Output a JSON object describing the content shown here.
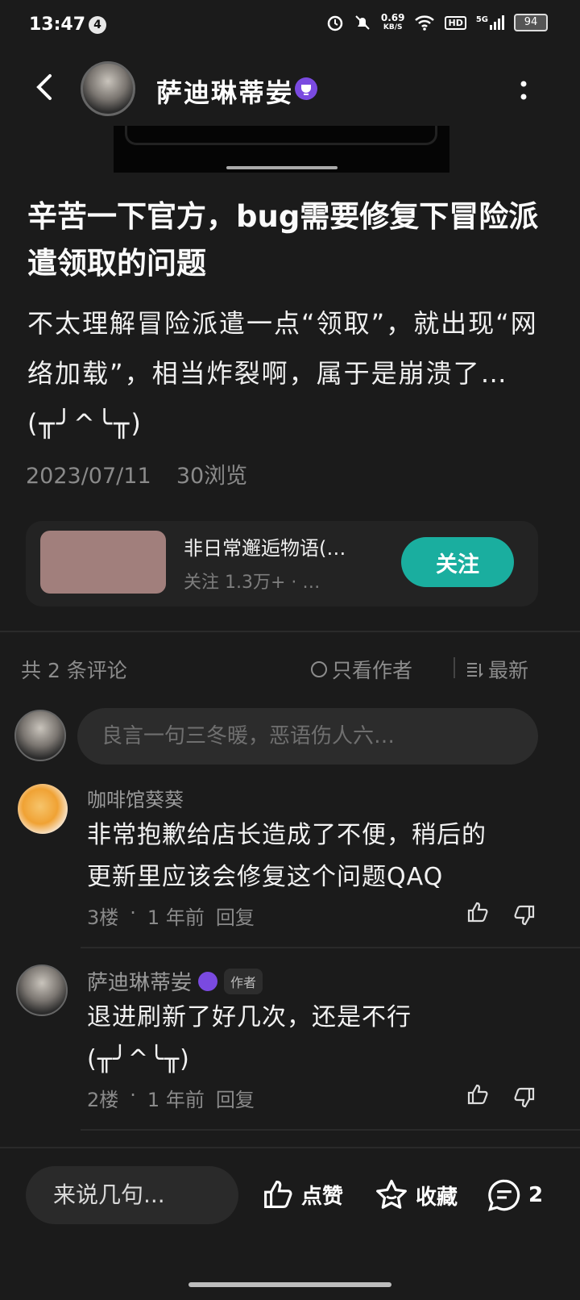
{
  "status_bar": {
    "time": "13:47",
    "notification_count": "4",
    "net_speed_value": "0.69",
    "net_speed_unit": "KB/S",
    "hd": "HD",
    "signal": "5G",
    "battery": "94"
  },
  "nav": {
    "author_name": "萨迪琳蒂妛"
  },
  "post": {
    "title": "辛苦一下官方，bug需要修复下冒险派遣领取的问题",
    "body": "不太理解冒险派遣一点“领取”，就出现“网络加载”，相当炸裂啊，属于是崩溃了…(╥╯^╰╥)",
    "date": "2023/07/11",
    "views": "30浏览"
  },
  "community_card": {
    "name": "非日常邂逅物语(…",
    "followers": "关注 1.3万+ · …",
    "follow_label": "关注"
  },
  "comments_header": {
    "count": "共 2 条评论",
    "author_only": "只看作者",
    "sort": "最新"
  },
  "comment_input": {
    "placeholder": "良言一句三冬暖，恶语伤人六…"
  },
  "comments": [
    {
      "name": "咖啡馆葵葵",
      "text_line1": "非常抱歉给店长造成了不便，稍后的",
      "text_line2": "更新里应该会修复这个问题QAQ",
      "floor": "3楼",
      "time": "1 年前",
      "reply": "回复"
    },
    {
      "name": "萨迪琳蒂妛",
      "author_tag": "作者",
      "text_line1": "退进刷新了好几次，还是不行",
      "text_line2": "(╥╯^╰╥)",
      "floor": "2楼",
      "time": "1 年前",
      "reply": "回复"
    }
  ],
  "bottom_bar": {
    "input_placeholder": "来说几句...",
    "like_label": "点赞",
    "favorite_label": "收藏",
    "comment_count": "2"
  },
  "colors": {
    "background": "#1b1b1b",
    "accent_teal": "#1aae9f",
    "vip_purple": "#7a4ae0"
  }
}
